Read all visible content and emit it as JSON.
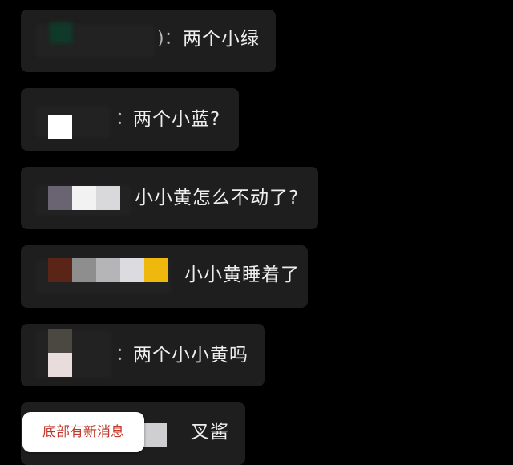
{
  "chat": {
    "messages": [
      {
        "sender_swatches": [
          "#0f3a2a"
        ],
        "separator": ")：",
        "text": "两个小绿"
      },
      {
        "sender_swatches": [
          "#ffffff"
        ],
        "separator": "：",
        "text": "两个小蓝?"
      },
      {
        "sender_swatches": [
          "#6a6472",
          "#f2f2f2",
          "#d9d9dc"
        ],
        "separator": "",
        "text": "小小黄怎么不动了?"
      },
      {
        "sender_swatches": [
          "#5a2416",
          "#8e8e8e",
          "#b5b5b8",
          "#dcdce0",
          "#eeb80c"
        ],
        "separator": "",
        "text": "小小黄睡着了"
      },
      {
        "sender_swatches": [
          "#4b4842",
          "#e8dcdc"
        ],
        "separator": "：",
        "text": "两个小小黄吗"
      },
      {
        "sender_swatches": [
          "#cfcfd2"
        ],
        "separator": "",
        "text": "叉酱"
      }
    ]
  },
  "toast": {
    "label": "底部有新消息",
    "color": "#c0392b"
  }
}
